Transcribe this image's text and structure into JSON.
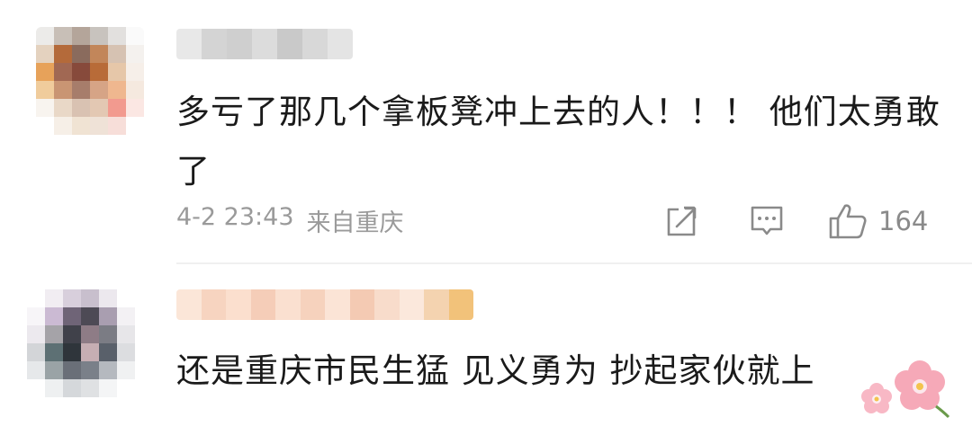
{
  "comments": [
    {
      "text": "多亏了那几个拿板凳冲上去的人！！！ 他们太勇敢了",
      "date": "4-2 23:43",
      "location": "来自重庆",
      "like_count": "164"
    },
    {
      "text": "还是重庆市民生猛 见义勇为 抄起家伙就上"
    }
  ],
  "icons": {
    "share": "share-icon",
    "reply": "comment-icon",
    "like": "thumbs-up-icon",
    "sticker": "cherry-blossom-icon"
  },
  "colors": {
    "text": "#1a1a1a",
    "meta": "#9a9a9a",
    "icon": "#8a8a8a"
  }
}
